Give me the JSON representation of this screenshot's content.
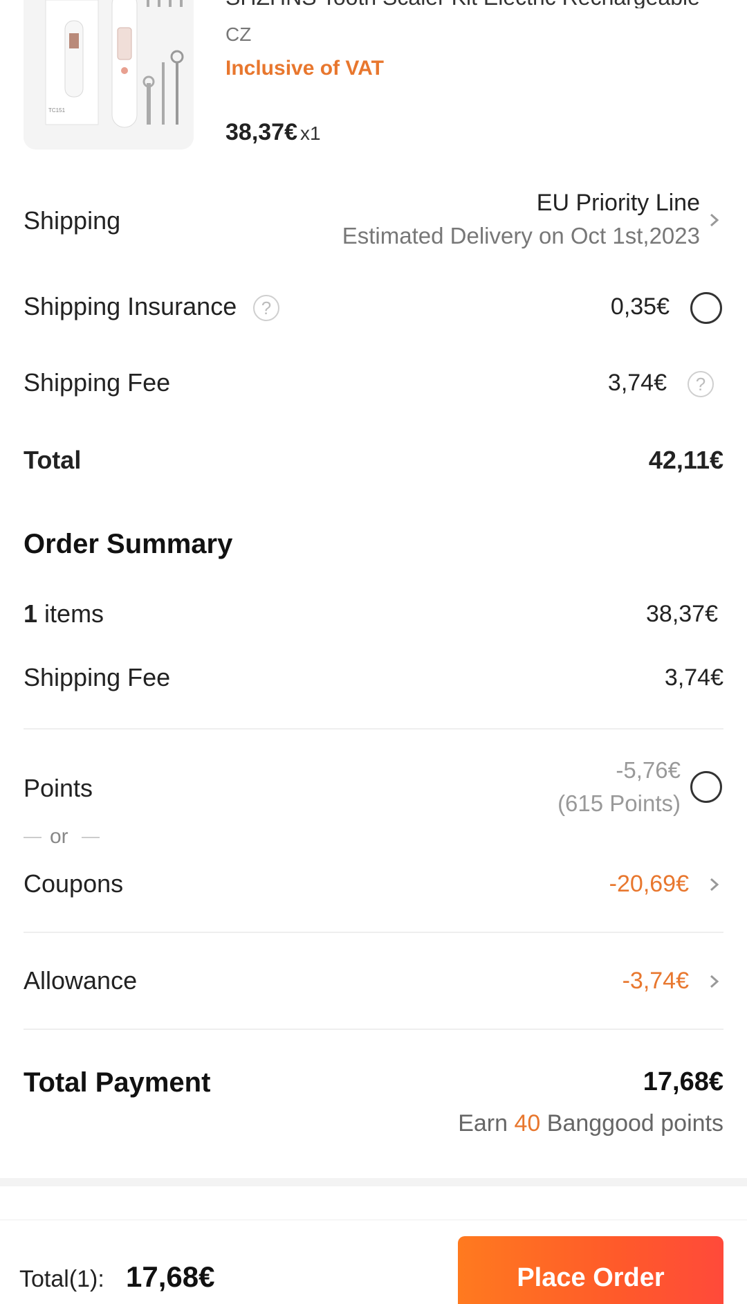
{
  "product": {
    "title": "SHZHNS Tooth Scaler Kit Electric Rechargeable",
    "origin": "CZ",
    "vat": "Inclusive of VAT",
    "price": "38,37€",
    "qty": "x1",
    "image_box_text": "TC151"
  },
  "shipping": {
    "label": "Shipping",
    "method": "EU Priority Line",
    "delivery": "Estimated Delivery on Oct 1st,2023"
  },
  "insurance": {
    "label": "Shipping Insurance",
    "value": "0,35€"
  },
  "shipping_fee": {
    "label": "Shipping Fee",
    "value": "3,74€"
  },
  "total": {
    "label": "Total",
    "value": "42,11€"
  },
  "summary": {
    "title": "Order Summary",
    "items_count": "1",
    "items_label": "items",
    "items_value": "38,37€",
    "fee_label": "Shipping Fee",
    "fee_value": "3,74€"
  },
  "points": {
    "label": "Points",
    "value": "-5,76€",
    "sub": "(615 Points)"
  },
  "or_text": "or",
  "coupons": {
    "label": "Coupons",
    "value": "-20,69€"
  },
  "allowance": {
    "label": "Allowance",
    "value": "-3,74€"
  },
  "total_payment": {
    "label": "Total Payment",
    "value": "17,68€",
    "earn_prefix": "Earn",
    "earn_points": "40",
    "earn_suffix": "Banggood points"
  },
  "footer": {
    "total_label": "Total(1):",
    "total_value": "17,68€",
    "button": "Place Order"
  },
  "colors": {
    "accent": "#e8772e",
    "button_start": "#ff7a1f",
    "button_end": "#ff4a3a"
  }
}
